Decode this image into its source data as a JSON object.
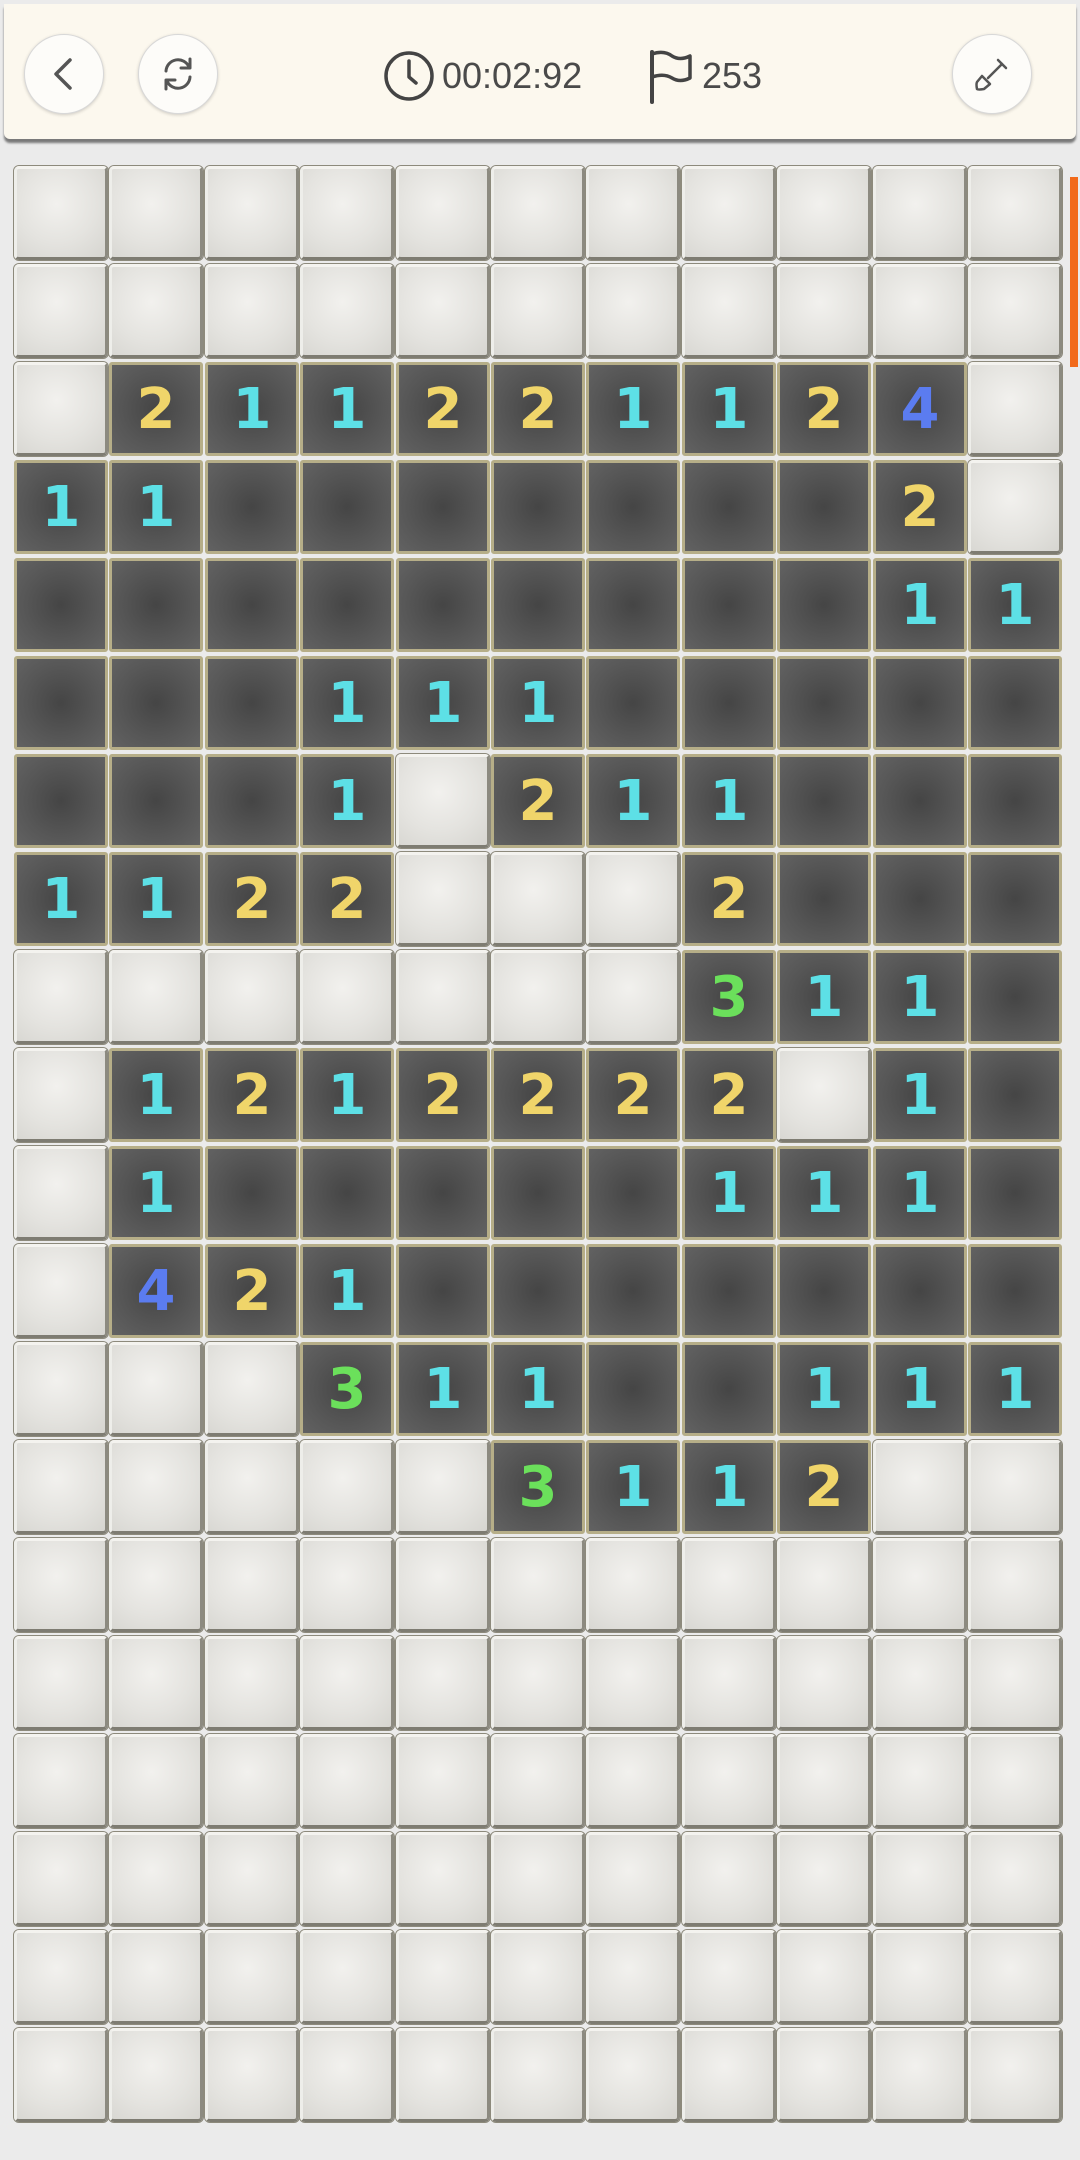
{
  "header": {
    "back_icon": "chevron-left-icon",
    "restart_icon": "refresh-icon",
    "timer_icon": "clock-icon",
    "timer": "00:02:92",
    "flag_icon": "flag-icon",
    "flags_remaining": "253",
    "tool_icon": "shovel-icon"
  },
  "colors": {
    "one": "#5de0e6",
    "two": "#f0d56a",
    "three": "#6be05b",
    "four": "#5b7cf0",
    "scroll_indicator": "#f26a1b"
  },
  "board": {
    "columns": 11,
    "rows": 20,
    "grid": [
      "###########",
      "###########",
      "#211221124#",
      "11.......2#",
      ".........11",
      "...111.....",
      "...1#211...",
      "1122###2...",
      "#######311.",
      "#1212222#1.",
      "#1.....111.",
      "#421.......",
      "###311..111",
      "#####3112##",
      "###########",
      "###########",
      "###########",
      "###########",
      "###########",
      "###########"
    ]
  }
}
